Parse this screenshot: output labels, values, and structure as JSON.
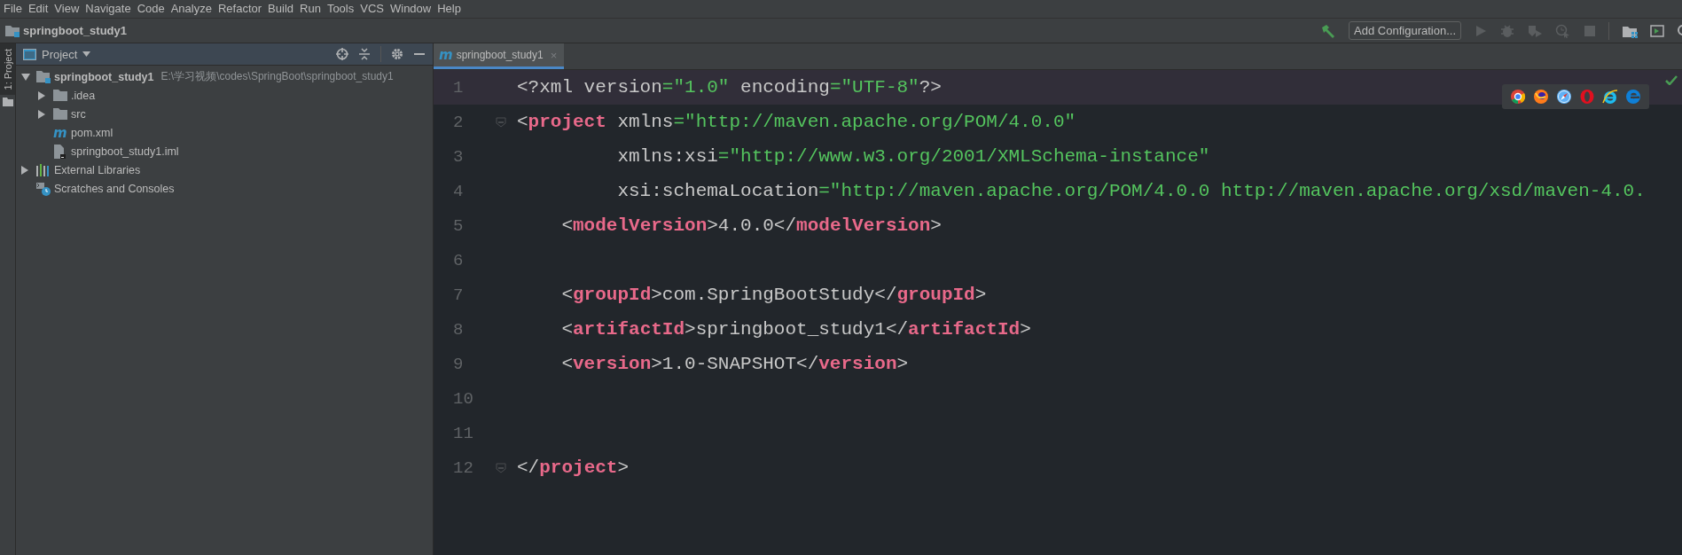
{
  "menu_bar": [
    "File",
    "Edit",
    "View",
    "Navigate",
    "Code",
    "Analyze",
    "Refactor",
    "Build",
    "Run",
    "Tools",
    "VCS",
    "Window",
    "Help"
  ],
  "navigation_bar": {
    "project": "springboot_study1"
  },
  "toolbar": {
    "configuration_button": "Add Configuration...",
    "actions": [
      {
        "kind": "build",
        "disabled": false
      },
      {
        "kind": "config"
      },
      {
        "kind": "run",
        "disabled": true
      },
      {
        "kind": "debug",
        "disabled": true
      },
      {
        "kind": "coverage",
        "disabled": true
      },
      {
        "kind": "profile",
        "disabled": true
      },
      {
        "kind": "stop",
        "disabled": true
      },
      {
        "kind": "separator"
      },
      {
        "kind": "structure",
        "disabled": false
      },
      {
        "kind": "terminal",
        "disabled": false
      },
      {
        "kind": "search",
        "disabled": false
      }
    ]
  },
  "tool_strip": {
    "tabs": [
      {
        "label": "1: Project",
        "selected": true
      }
    ]
  },
  "project_panel": {
    "title": "Project",
    "tree": [
      {
        "label": "springboot_study1",
        "path": "E:\\学习视频\\codes\\SpringBoot\\springboot_study1",
        "kind": "module",
        "expanded": true,
        "children": [
          {
            "label": ".idea",
            "kind": "folder",
            "expanded": false
          },
          {
            "label": "src",
            "kind": "folder",
            "expanded": false
          },
          {
            "label": "pom.xml",
            "kind": "maven",
            "icon_glyph": "m"
          },
          {
            "label": "springboot_study1.iml",
            "kind": "file"
          }
        ]
      },
      {
        "label": "External Libraries",
        "kind": "libraries",
        "expanded": false
      },
      {
        "label": "Scratches and Consoles",
        "kind": "scratches"
      }
    ]
  },
  "editor": {
    "tabs": [
      {
        "label": "springboot_study1",
        "icon_glyph": "m",
        "close": "×",
        "selected": true
      }
    ],
    "lines": [
      {
        "number": "1",
        "current": true,
        "fold": false,
        "tokens": [
          {
            "kind": "plain",
            "text": "<?xml version"
          },
          {
            "kind": "string",
            "text": "=\"1.0\""
          },
          {
            "kind": "plain",
            "text": " encoding"
          },
          {
            "kind": "string",
            "text": "=\"UTF-8\""
          },
          {
            "kind": "plain",
            "text": "?>"
          }
        ]
      },
      {
        "number": "2",
        "current": false,
        "fold": true,
        "tokens": [
          {
            "kind": "plain",
            "text": "<"
          },
          {
            "kind": "tag",
            "text": "project"
          },
          {
            "kind": "plain",
            "text": " xmlns"
          },
          {
            "kind": "string",
            "text": "=\"http://maven.apache.org/POM/4.0.0\""
          }
        ]
      },
      {
        "number": "3",
        "current": false,
        "fold": false,
        "tokens": [
          {
            "kind": "plain",
            "text": "         xmlns:xsi"
          },
          {
            "kind": "string",
            "text": "=\"http://www.w3.org/2001/XMLSchema-instance\""
          }
        ]
      },
      {
        "number": "4",
        "current": false,
        "fold": false,
        "tokens": [
          {
            "kind": "plain",
            "text": "         xsi:schemaLocation"
          },
          {
            "kind": "string",
            "text": "=\"http://maven.apache.org/POM/4.0.0 http://maven.apache.org/xsd/maven-4.0."
          }
        ]
      },
      {
        "number": "5",
        "current": false,
        "fold": false,
        "tokens": [
          {
            "kind": "plain",
            "text": "    <"
          },
          {
            "kind": "tag",
            "text": "modelVersion"
          },
          {
            "kind": "plain",
            "text": ">4.0.0</"
          },
          {
            "kind": "tag",
            "text": "modelVersion"
          },
          {
            "kind": "plain",
            "text": ">"
          }
        ]
      },
      {
        "number": "6",
        "current": false,
        "fold": false
      },
      {
        "number": "7",
        "current": false,
        "fold": false,
        "tokens": [
          {
            "kind": "plain",
            "text": "    <"
          },
          {
            "kind": "tag",
            "text": "groupId"
          },
          {
            "kind": "plain",
            "text": ">com.SpringBootStudy</"
          },
          {
            "kind": "tag",
            "text": "groupId"
          },
          {
            "kind": "plain",
            "text": ">"
          }
        ]
      },
      {
        "number": "8",
        "current": false,
        "fold": false,
        "tokens": [
          {
            "kind": "plain",
            "text": "    <"
          },
          {
            "kind": "tag",
            "text": "artifactId"
          },
          {
            "kind": "plain",
            "text": ">springboot_study1</"
          },
          {
            "kind": "tag",
            "text": "artifactId"
          },
          {
            "kind": "plain",
            "text": ">"
          }
        ]
      },
      {
        "number": "9",
        "current": false,
        "fold": false,
        "tokens": [
          {
            "kind": "plain",
            "text": "    <"
          },
          {
            "kind": "tag",
            "text": "version"
          },
          {
            "kind": "plain",
            "text": ">1.0-SNAPSHOT</"
          },
          {
            "kind": "tag",
            "text": "version"
          },
          {
            "kind": "plain",
            "text": ">"
          }
        ]
      },
      {
        "number": "10",
        "current": false,
        "fold": false
      },
      {
        "number": "11",
        "current": false,
        "fold": false
      },
      {
        "number": "12",
        "current": false,
        "fold": true,
        "tokens": [
          {
            "kind": "plain",
            "text": "</"
          },
          {
            "kind": "tag",
            "text": "project"
          },
          {
            "kind": "plain",
            "text": ">"
          }
        ]
      }
    ],
    "browser_popup": [
      {
        "kind": "chrome"
      },
      {
        "kind": "firefox"
      },
      {
        "kind": "safari"
      },
      {
        "kind": "opera"
      },
      {
        "kind": "ie"
      },
      {
        "kind": "edge"
      }
    ]
  }
}
